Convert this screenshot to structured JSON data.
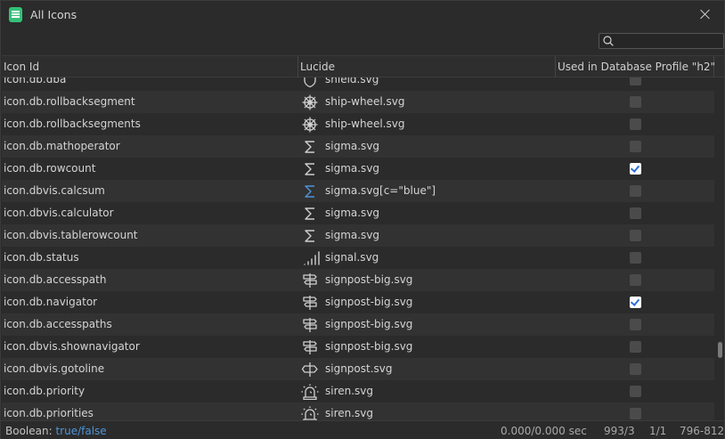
{
  "window": {
    "title": "All Icons"
  },
  "search": {
    "placeholder": "",
    "value": ""
  },
  "table": {
    "columns": [
      "Icon Id",
      "Lucide",
      "Used in Database Profile \"h2\""
    ],
    "rows": [
      {
        "id": "icon.db.dba",
        "file": "shield.svg",
        "icon": "shield-icon",
        "checked": false
      },
      {
        "id": "icon.db.rollbacksegment",
        "file": "ship-wheel.svg",
        "icon": "ship-wheel-icon",
        "checked": false
      },
      {
        "id": "icon.db.rollbacksegments",
        "file": "ship-wheel.svg",
        "icon": "ship-wheel-icon",
        "checked": false
      },
      {
        "id": "icon.db.mathoperator",
        "file": "sigma.svg",
        "icon": "sigma-icon",
        "checked": false
      },
      {
        "id": "icon.db.rowcount",
        "file": "sigma.svg",
        "icon": "sigma-icon",
        "checked": true
      },
      {
        "id": "icon.dbvis.calcsum",
        "file": "sigma.svg[c=\"blue\"]",
        "icon": "sigma-blue-icon",
        "checked": false
      },
      {
        "id": "icon.dbvis.calculator",
        "file": "sigma.svg",
        "icon": "sigma-icon",
        "checked": false
      },
      {
        "id": "icon.dbvis.tablerowcount",
        "file": "sigma.svg",
        "icon": "sigma-icon",
        "checked": false
      },
      {
        "id": "icon.db.status",
        "file": "signal.svg",
        "icon": "signal-icon",
        "checked": false
      },
      {
        "id": "icon.db.accesspath",
        "file": "signpost-big.svg",
        "icon": "signpost-big-icon",
        "checked": false
      },
      {
        "id": "icon.db.navigator",
        "file": "signpost-big.svg",
        "icon": "signpost-big-icon",
        "checked": true
      },
      {
        "id": "icon.db.accesspaths",
        "file": "signpost-big.svg",
        "icon": "signpost-big-icon",
        "checked": false
      },
      {
        "id": "icon.dbvis.shownavigator",
        "file": "signpost-big.svg",
        "icon": "signpost-big-icon",
        "checked": false
      },
      {
        "id": "icon.dbvis.gotoline",
        "file": "signpost.svg",
        "icon": "signpost-icon",
        "checked": false
      },
      {
        "id": "icon.db.priority",
        "file": "siren.svg",
        "icon": "siren-icon",
        "checked": false
      },
      {
        "id": "icon.db.priorities",
        "file": "siren.svg",
        "icon": "siren-icon",
        "checked": false
      }
    ]
  },
  "status": {
    "boolean_label": "Boolean:",
    "boolean_value": "true/false",
    "time": "0.000/0.000 sec",
    "count": "993/3",
    "page": "1/1",
    "range": "796-812"
  },
  "colors": {
    "accent": "#4f94d9",
    "app_icon": "#34c07a",
    "checkbox_check": "#2a6fd6"
  }
}
